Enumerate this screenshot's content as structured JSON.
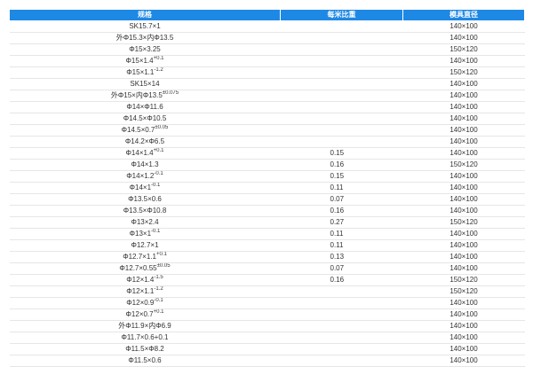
{
  "table": {
    "headers": [
      "规格",
      "每米比重",
      "模具直径"
    ],
    "rows": [
      {
        "spec": "SK15.7×1",
        "sup": "",
        "ratio": "",
        "diameter": "140×100"
      },
      {
        "spec": "外Φ15.3×内Φ13.5",
        "sup": "",
        "ratio": "",
        "diameter": "140×100"
      },
      {
        "spec": "Φ15×3.25",
        "sup": "",
        "ratio": "",
        "diameter": "150×120"
      },
      {
        "spec": "Φ15×1.4",
        "sup": "+0.1",
        "ratio": "",
        "diameter": "140×100"
      },
      {
        "spec": "Φ15×1.1",
        "sup": "-1.2",
        "ratio": "",
        "diameter": "150×120"
      },
      {
        "spec": "SK15×14",
        "sup": "",
        "ratio": "",
        "diameter": "140×100"
      },
      {
        "spec": "外Φ15×内Φ13.5",
        "sup": "±0.075",
        "ratio": "",
        "diameter": "140×100"
      },
      {
        "spec": "Φ14×Φ11.6",
        "sup": "",
        "ratio": "",
        "diameter": "140×100"
      },
      {
        "spec": "Φ14.5×Φ10.5",
        "sup": "",
        "ratio": "",
        "diameter": "140×100"
      },
      {
        "spec": "Φ14.5×0.7",
        "sup": "±0.05",
        "ratio": "",
        "diameter": "140×100"
      },
      {
        "spec": "Φ14.2×Φ6.5",
        "sup": "",
        "ratio": "",
        "diameter": "140×100"
      },
      {
        "spec": "Φ14×1.4",
        "sup": "+0.1",
        "ratio": "0.15",
        "diameter": "140×100"
      },
      {
        "spec": "Φ14×1.3",
        "sup": "",
        "ratio": "0.16",
        "diameter": "150×120"
      },
      {
        "spec": "Φ14×1.2",
        "sup": "-0.1",
        "ratio": "0.15",
        "diameter": "140×100"
      },
      {
        "spec": "Φ14×1",
        "sup": "-0.1",
        "ratio": "0.11",
        "diameter": "140×100"
      },
      {
        "spec": "Φ13.5×0.6",
        "sup": "",
        "ratio": "0.07",
        "diameter": "140×100"
      },
      {
        "spec": "Φ13.5×Φ10.8",
        "sup": "",
        "ratio": "0.16",
        "diameter": "140×100"
      },
      {
        "spec": "Φ13×2.4",
        "sup": "",
        "ratio": "0.27",
        "diameter": "150×120"
      },
      {
        "spec": "Φ13×1",
        "sup": "-0.1",
        "ratio": "0.11",
        "diameter": "140×100"
      },
      {
        "spec": "Φ12.7×1",
        "sup": "",
        "ratio": "0.11",
        "diameter": "140×100"
      },
      {
        "spec": "Φ12.7×1.1",
        "sup": "+0.1",
        "ratio": "0.13",
        "diameter": "140×100"
      },
      {
        "spec": "Φ12.7×0.55",
        "sup": "±0.05",
        "ratio": "0.07",
        "diameter": "140×100"
      },
      {
        "spec": "Φ12×1.4",
        "sup": "-1.5",
        "ratio": "0.16",
        "diameter": "150×120"
      },
      {
        "spec": "Φ12×1.1",
        "sup": "-1.2",
        "ratio": "",
        "diameter": "150×120"
      },
      {
        "spec": "Φ12×0.9",
        "sup": "-0.1",
        "ratio": "",
        "diameter": "140×100"
      },
      {
        "spec": "Φ12×0.7",
        "sup": "+0.1",
        "ratio": "",
        "diameter": "140×100"
      },
      {
        "spec": "外Φ11.9×内Φ6.9",
        "sup": "",
        "ratio": "",
        "diameter": "140×100"
      },
      {
        "spec": "Φ11.7×0.6+0.1",
        "sup": "",
        "ratio": "",
        "diameter": "140×100"
      },
      {
        "spec": "Φ11.5×Φ8.2",
        "sup": "",
        "ratio": "",
        "diameter": "140×100"
      },
      {
        "spec": "Φ11.5×0.6",
        "sup": "",
        "ratio": "",
        "diameter": "140×100"
      }
    ]
  }
}
